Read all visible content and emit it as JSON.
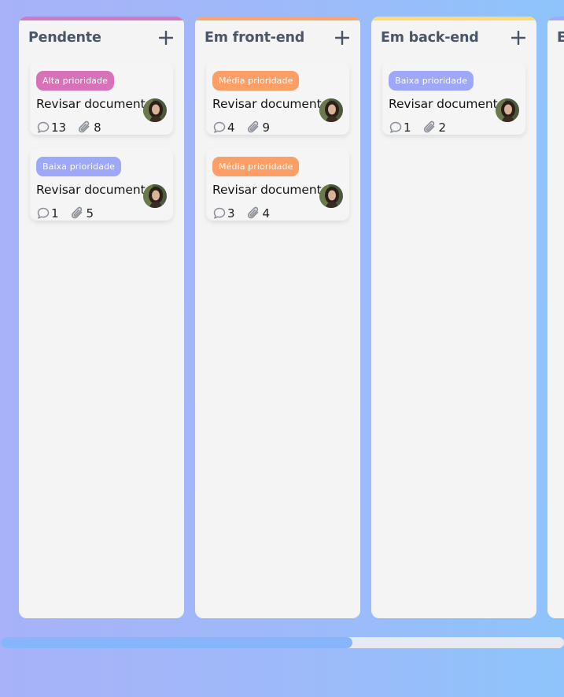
{
  "colors": {
    "pendente": "#cf79c4",
    "front": "#f8a66d",
    "back": "#fadb78",
    "teste": "#a3a9f5",
    "alta": "#d772b8",
    "media": "#fb9f67",
    "baixa": "#9ea8f8"
  },
  "columns": [
    {
      "title": "Pendente",
      "add_icon": "plus-icon",
      "cards": [
        {
          "badge": "Alta prioridade",
          "title": "Revisar documento",
          "comments": "13",
          "attachments": "8"
        },
        {
          "badge": "Baixa prioridade",
          "title": "Revisar documento",
          "comments": "1",
          "attachments": "5"
        }
      ]
    },
    {
      "title": "Em front-end",
      "add_icon": "plus-icon",
      "cards": [
        {
          "badge": "Média prioridade",
          "title": "Revisar documento",
          "comments": "4",
          "attachments": "9"
        },
        {
          "badge": "Média prioridade",
          "title": "Revisar documento",
          "comments": "3",
          "attachments": "4"
        }
      ]
    },
    {
      "title": "Em back-end",
      "add_icon": "plus-icon",
      "cards": [
        {
          "badge": "Baixa prioridade",
          "title": "Revisar documento",
          "comments": "1",
          "attachments": "2"
        }
      ]
    },
    {
      "title": "E",
      "cards": []
    }
  ],
  "scrollbar": {
    "position_fraction": 0.62
  }
}
